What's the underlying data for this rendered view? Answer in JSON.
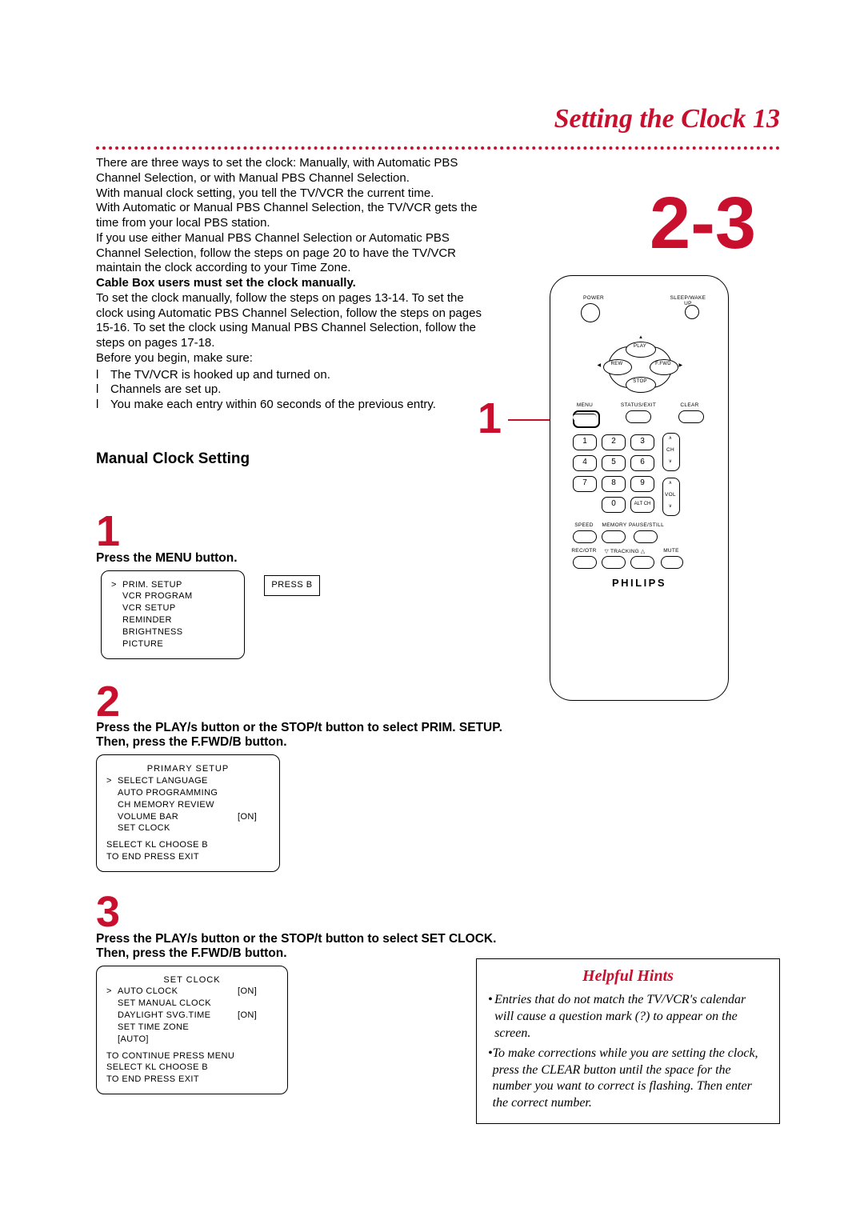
{
  "title": "Setting the Clock  13",
  "intro": {
    "p1": "There are three ways to set the clock: Manually, with Automatic PBS Channel Selection, or with Manual PBS Channel Selection.",
    "p2": "With manual clock setting, you tell the TV/VCR the current time.",
    "p3": "With Automatic or Manual PBS Channel Selection, the TV/VCR gets the time from your local PBS station.",
    "p4": "If you use either Manual PBS Channel Selection or Automatic PBS Channel Selection, follow the steps on page 20 to have the TV/VCR maintain the clock according to your Time Zone.",
    "bold": "Cable Box users must set the clock manually.",
    "p5": "To set the clock manually, follow the steps on pages 13-14. To set the clock using Automatic PBS Channel Selection, follow the steps on pages 15-16. To set the clock using Manual PBS Channel Selection, follow the steps on pages 17-18.",
    "p6": "Before you begin, make sure:",
    "b1": "The TV/VCR is hooked up and turned on.",
    "b2": "Channels are set up.",
    "b3": "You make each entry within 60 seconds of the previous entry."
  },
  "bullet_glyph": "l",
  "section_heading": "Manual Clock Setting",
  "steps": {
    "s1": {
      "num": "1",
      "label": "Press the MENU button."
    },
    "s2": {
      "num": "2",
      "label_a": "Press the PLAY/",
      "sym_a": "s",
      "label_b": "  button or the STOP/",
      "sym_b": "t",
      "label_c": "  button to select PRIM. SETUP.  Then, press the F.FWD/",
      "sym_c": "B",
      "label_d": "  button."
    },
    "s3": {
      "num": "3",
      "label_a": "Press the PLAY/",
      "sym_a": "s",
      "label_b": "  button or the STOP/",
      "sym_b": "t",
      "label_c": "  button to select SET CLOCK. Then, press the F.FWD/",
      "sym_c": "B",
      "label_d": "  button."
    }
  },
  "osd1": {
    "lines": [
      "PRIM. SETUP",
      "VCR PROGRAM",
      "VCR SETUP",
      "REMINDER",
      "BRIGHTNESS",
      "PICTURE"
    ],
    "pressb": "PRESS B"
  },
  "osd2": {
    "title": "PRIMARY SETUP",
    "lines": [
      {
        "sel": ">",
        "t": "SELECT LANGUAGE",
        "v": ""
      },
      {
        "sel": "",
        "t": "AUTO PROGRAMMING",
        "v": ""
      },
      {
        "sel": "",
        "t": "CH MEMORY REVIEW",
        "v": ""
      },
      {
        "sel": "",
        "t": "VOLUME BAR",
        "v": "[ON]"
      },
      {
        "sel": "",
        "t": "SET CLOCK",
        "v": ""
      }
    ],
    "foot1": "SELECT KL  CHOOSE B",
    "foot2": "TO  END  PRESS EXIT"
  },
  "osd3": {
    "title": "SET CLOCK",
    "lines": [
      {
        "sel": ">",
        "t": "AUTO CLOCK",
        "v": "[ON]"
      },
      {
        "sel": "",
        "t": "SET MANUAL CLOCK",
        "v": ""
      },
      {
        "sel": "",
        "t": "DAYLIGHT SVG.TIME",
        "v": "[ON]"
      },
      {
        "sel": "",
        "t": "SET TIME ZONE",
        "v": ""
      },
      {
        "sel": "",
        "t": "[AUTO]",
        "v": ""
      }
    ],
    "foot1": "TO CONTINUE PRESS MENU",
    "foot2": "SELECT KL  CHOOSE B",
    "foot3": "TO  END  PRESS EXIT"
  },
  "remote": {
    "big": "2-3",
    "side": "1",
    "labels": {
      "power": "POWER",
      "sleep": "SLEEP/WAKE UP",
      "play": "PLAY",
      "rew": "REW",
      "ffwd": "F.FWD",
      "stop": "STOP",
      "menu": "MENU",
      "status": "STATUS/EXIT",
      "clear": "CLEAR",
      "altch": "ALT CH",
      "ch": "CH",
      "vol": "VOL",
      "speed": "SPEED",
      "memory": "MEMORY",
      "pause": "PAUSE/STILL",
      "rec": "REC/OTR",
      "trackdn": "▽  TRACKING  △",
      "mute": "MUTE"
    },
    "keys": [
      "1",
      "2",
      "3",
      "4",
      "5",
      "6",
      "7",
      "8",
      "9",
      "0"
    ],
    "brand": "PHILIPS"
  },
  "hints": {
    "title": "Helpful Hints",
    "i1": "Entries that do not match the TV/VCR's calendar will cause a question mark (?) to appear on the screen.",
    "i2": "To make corrections while you are setting the clock, press the CLEAR button until the space for the number you want to correct is flashing. Then enter the correct number."
  }
}
